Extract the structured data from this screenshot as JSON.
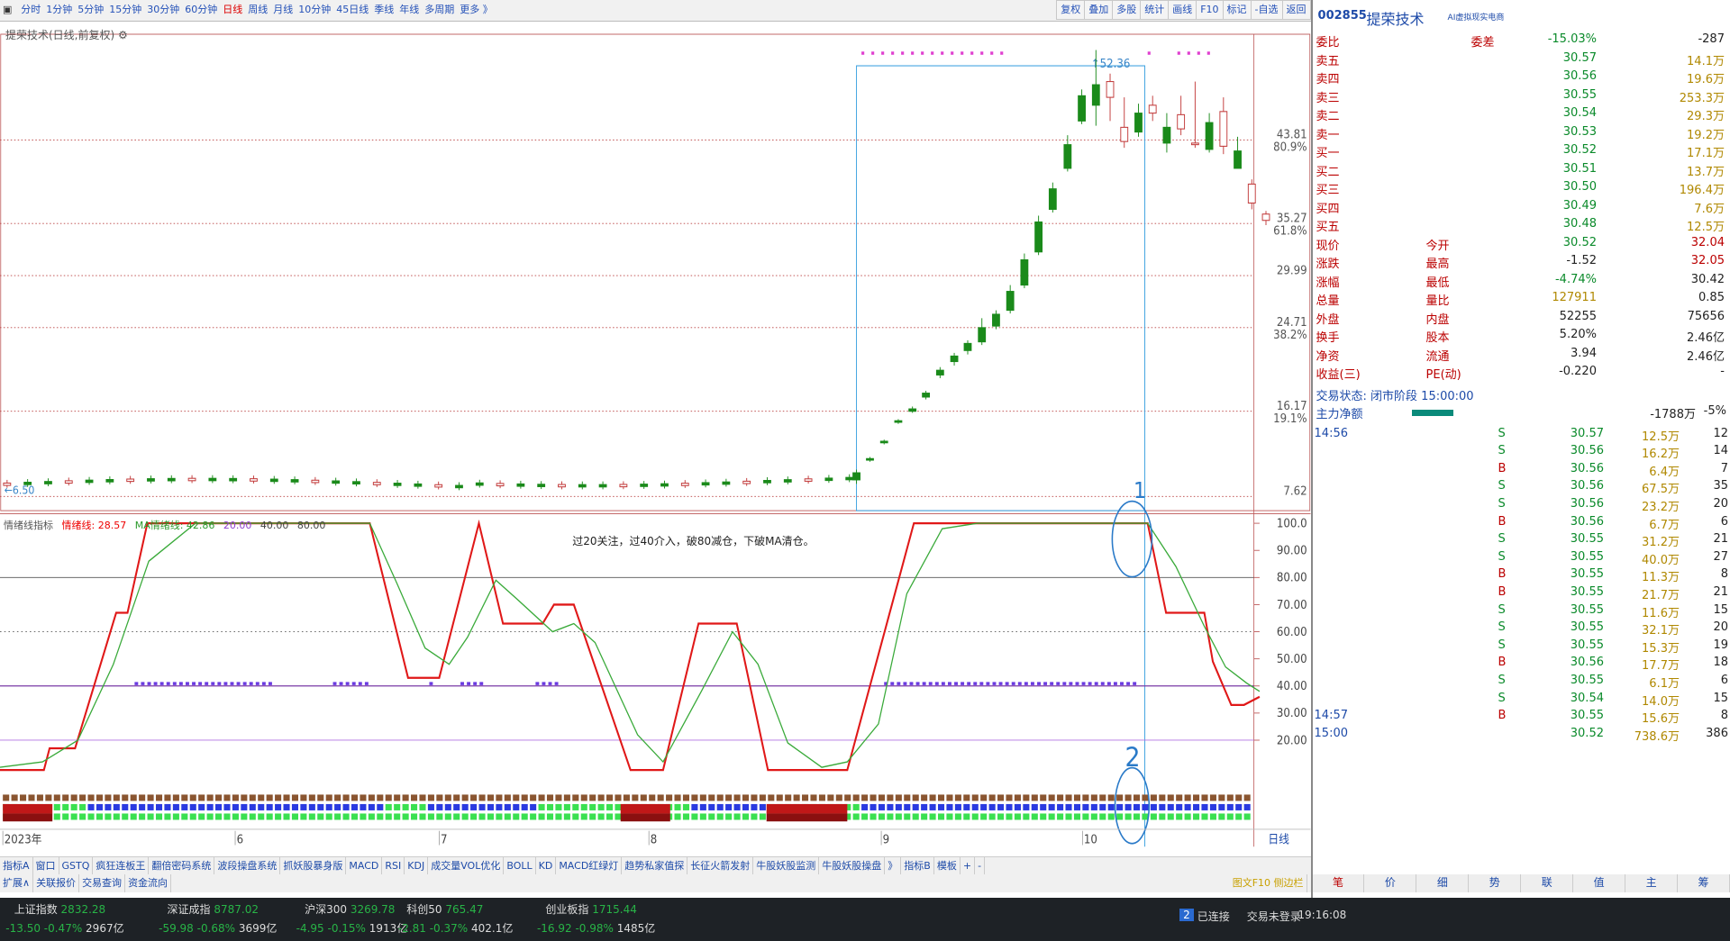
{
  "timeframes": [
    "分时",
    "1分钟",
    "5分钟",
    "15分钟",
    "30分钟",
    "60分钟",
    "日线",
    "周线",
    "月线",
    "10分钟",
    "45日线",
    "季线",
    "年线",
    "多周期",
    "更多 》"
  ],
  "active_timeframe": "日线",
  "tools": [
    "复权",
    "叠加",
    "多股",
    "统计",
    "画线",
    "F10",
    "标记",
    "-自选",
    "返回"
  ],
  "stock": {
    "title": "提荣技术(日线,前复权)",
    "code": "002855",
    "name": "提荣技术",
    "subtitle": "AI虚拟现实电商"
  },
  "price_axis": [
    {
      "v": "43.81",
      "p": "80.9%"
    },
    {
      "v": "35.27",
      "p": "61.8%"
    },
    {
      "v": "29.99",
      "p": ""
    },
    {
      "v": "24.71",
      "p": "38.2%"
    },
    {
      "v": "16.17",
      "p": "19.1%"
    },
    {
      "v": "7.62",
      "p": ""
    }
  ],
  "price_marks": {
    "high": "52.36",
    "low": "6.50"
  },
  "indicator": {
    "name": "情绪线指标",
    "line1": "情绪线: 28.57",
    "line2": "MA情绪线: 42.86",
    "v1": "20.00",
    "v2": "40.00",
    "v3": "80.00",
    "note": "过20关注，过40介入，破80减仓，下破MA清仓。",
    "axis": [
      "100.0",
      "90.00",
      "80.00",
      "70.00",
      "60.00",
      "50.00",
      "40.00",
      "30.00",
      "20.00"
    ]
  },
  "dates": [
    "2023年",
    "6",
    "7",
    "8",
    "9",
    "10"
  ],
  "xlabel": "日线",
  "tabs_row1": [
    "指标A",
    "窗口",
    "GSTQ",
    "疯狂连板王",
    "翻倍密码系统",
    "波段操盘系统",
    "抓妖股暴身版",
    "MACD",
    "RSI",
    "KDJ",
    "成交量VOL优化",
    "BOLL",
    "KD",
    "MACD红绿灯",
    "趋势私家值探",
    "长征火箭发射",
    "牛股妖股监测",
    "牛股妖股操盘",
    "》",
    "指标B",
    "模板",
    "+",
    "-"
  ],
  "tabs_row2": [
    "扩展∧",
    "关联报价",
    "交易查询",
    "资金流向"
  ],
  "right_tabs": [
    "笔",
    "价",
    "细",
    "势",
    "联",
    "值",
    "主",
    "筹"
  ],
  "f10": "图文F10",
  "sidebar_btn": "侧边栏",
  "order": {
    "webi": "委比",
    "webi_v": "-15.03%",
    "wecha": "委差",
    "wecha_v": "-287",
    "asks": [
      {
        "l": "卖五",
        "p": "30.57",
        "q": "14.1万"
      },
      {
        "l": "卖四",
        "p": "30.56",
        "q": "19.6万"
      },
      {
        "l": "卖三",
        "p": "30.55",
        "q": "253.3万"
      },
      {
        "l": "卖二",
        "p": "30.54",
        "q": "29.3万"
      },
      {
        "l": "卖一",
        "p": "30.53",
        "q": "19.2万"
      }
    ],
    "bids": [
      {
        "l": "买一",
        "p": "30.52",
        "q": "17.1万"
      },
      {
        "l": "买二",
        "p": "30.51",
        "q": "13.7万"
      },
      {
        "l": "买三",
        "p": "30.50",
        "q": "196.4万"
      },
      {
        "l": "买四",
        "p": "30.49",
        "q": "7.6万"
      },
      {
        "l": "买五",
        "p": "30.48",
        "q": "12.5万"
      }
    ]
  },
  "quote": [
    {
      "a": "现价",
      "av": "30.52",
      "b": "今开",
      "bv": "32.04"
    },
    {
      "a": "涨跌",
      "av": "-1.52",
      "b": "最高",
      "bv": "32.05"
    },
    {
      "a": "涨幅",
      "av": "-4.74%",
      "b": "最低",
      "bv": "30.42"
    },
    {
      "a": "总量",
      "av": "127911",
      "b": "量比",
      "bv": "0.85"
    },
    {
      "a": "外盘",
      "av": "52255",
      "b": "内盘",
      "bv": "75656"
    },
    {
      "a": "换手",
      "av": "5.20%",
      "b": "股本",
      "bv": "2.46亿"
    },
    {
      "a": "净资",
      "av": "3.94",
      "b": "流通",
      "bv": "2.46亿"
    },
    {
      "a": "收益(三)",
      "av": "-0.220",
      "b": "PE(动)",
      "bv": "-"
    }
  ],
  "trade_status": "交易状态: 闭市阶段 15:00:00",
  "main_net": {
    "l": "主力净额",
    "v": "-1788万",
    "p": "-5%"
  },
  "ticks": [
    {
      "t": "14:56",
      "p": "30.57",
      "v": "12.5万",
      "s": "S",
      "n": "12"
    },
    {
      "t": "",
      "p": "30.56",
      "v": "16.2万",
      "s": "S",
      "n": "14"
    },
    {
      "t": "",
      "p": "30.56",
      "v": "6.4万",
      "s": "B",
      "n": "7"
    },
    {
      "t": "",
      "p": "30.56",
      "v": "67.5万",
      "s": "S",
      "n": "35"
    },
    {
      "t": "",
      "p": "30.56",
      "v": "23.2万",
      "s": "S",
      "n": "20"
    },
    {
      "t": "",
      "p": "30.56",
      "v": "6.7万",
      "s": "B",
      "n": "6"
    },
    {
      "t": "",
      "p": "30.55",
      "v": "31.2万",
      "s": "S",
      "n": "21"
    },
    {
      "t": "",
      "p": "30.55",
      "v": "40.0万",
      "s": "S",
      "n": "27"
    },
    {
      "t": "",
      "p": "30.55",
      "v": "11.3万",
      "s": "B",
      "n": "8"
    },
    {
      "t": "",
      "p": "30.55",
      "v": "21.7万",
      "s": "B",
      "n": "21"
    },
    {
      "t": "",
      "p": "30.55",
      "v": "11.6万",
      "s": "S",
      "n": "15"
    },
    {
      "t": "",
      "p": "30.55",
      "v": "32.1万",
      "s": "S",
      "n": "20"
    },
    {
      "t": "",
      "p": "30.55",
      "v": "15.3万",
      "s": "S",
      "n": "19"
    },
    {
      "t": "",
      "p": "30.56",
      "v": "17.7万",
      "s": "B",
      "n": "18"
    },
    {
      "t": "",
      "p": "30.55",
      "v": "6.1万",
      "s": "S",
      "n": "6"
    },
    {
      "t": "",
      "p": "30.54",
      "v": "14.0万",
      "s": "S",
      "n": "15"
    },
    {
      "t": "14:57",
      "p": "30.55",
      "v": "15.6万",
      "s": "B",
      "n": "8"
    },
    {
      "t": "15:00",
      "p": "30.52",
      "v": "738.6万",
      "s": "",
      "n": "386"
    }
  ],
  "indices": [
    {
      "name": "上证指数",
      "val": "2832.28",
      "chg": "-13.50",
      "pct": "-0.47%",
      "amt": "2967亿"
    },
    {
      "name": "深证成指",
      "val": "8787.02",
      "chg": "-59.98",
      "pct": "-0.68%",
      "amt": "3699亿"
    },
    {
      "name": "沪深300",
      "val": "3269.78",
      "chg": "-4.95",
      "pct": "-0.15%",
      "amt": "1913亿"
    },
    {
      "name": "科创50",
      "val": "765.47",
      "chg": "-2.81",
      "pct": "-0.37%",
      "amt": "402.1亿"
    },
    {
      "name": "创业板指",
      "val": "1715.44",
      "chg": "-16.92",
      "pct": "-0.98%",
      "amt": "1485亿"
    }
  ],
  "conn": {
    "count": "2",
    "text": "已连接",
    "login": "交易未登录"
  },
  "clock": "19:16:08",
  "handwriting": [
    "1",
    "2"
  ]
}
